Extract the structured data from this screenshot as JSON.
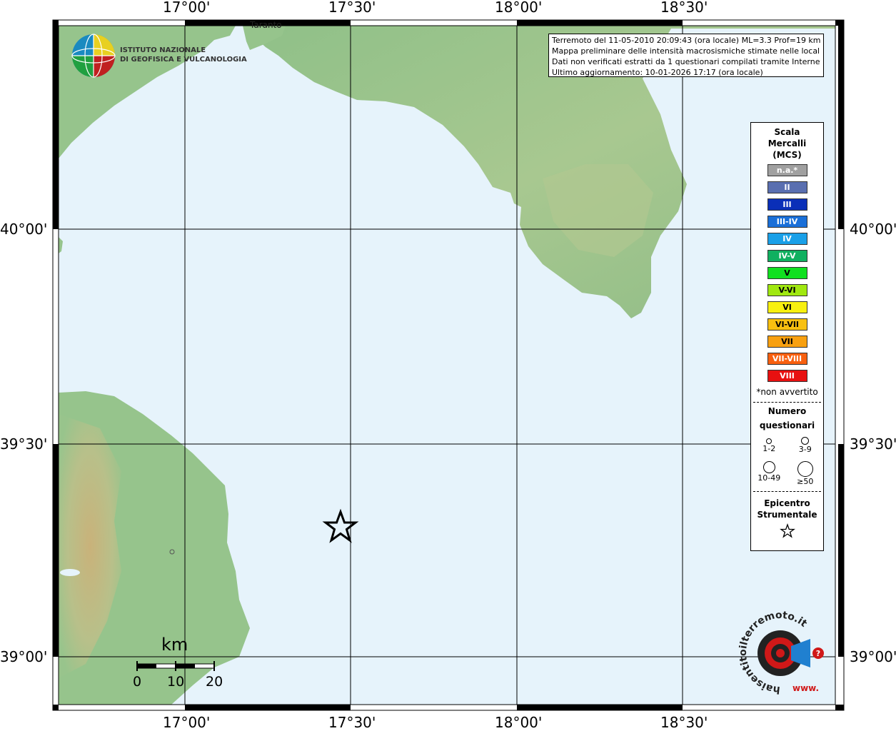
{
  "info": {
    "line1": "Terremoto del 11-05-2010 20:09:43 (ora locale) ML=3.3 Prof=19 km",
    "line2": "Mappa preliminare delle intensità macrosismiche stimate nelle località",
    "line3": "Dati non verificati estratti da 1 questionari compilati tramite Internet.",
    "line4": "Ultimo aggiornamento: 10-01-2026 17:17 (ora locale)"
  },
  "axes": {
    "top": [
      "17°00'",
      "17°30'",
      "18°00'",
      "18°30'"
    ],
    "bottom": [
      "17°00'",
      "17°30'",
      "18°00'",
      "18°30'"
    ],
    "left": [
      "40°00'",
      "39°30'",
      "39°00'"
    ],
    "right": [
      "40°00'",
      "39°30'",
      "39°00'"
    ]
  },
  "institute": {
    "line1": "ISTITUTO NAZIONALE",
    "line2": "DI GEOFISICA E VULCANOLOGIA"
  },
  "place": {
    "taranto": "Taranto"
  },
  "legend": {
    "title": [
      "Scala",
      "Mercalli",
      "(MCS)"
    ],
    "scale": [
      {
        "label": "n.a.*",
        "color": "#a0a0a0"
      },
      {
        "label": "II",
        "color": "#5a6fb0"
      },
      {
        "label": "III",
        "color": "#0a2fb8"
      },
      {
        "label": "III-IV",
        "color": "#1a6fd8"
      },
      {
        "label": "IV",
        "color": "#1aa0e8"
      },
      {
        "label": "IV-V",
        "color": "#10b060"
      },
      {
        "label": "V",
        "color": "#10e020"
      },
      {
        "label": "V-VI",
        "color": "#a0e810"
      },
      {
        "label": "VI",
        "color": "#f8f010"
      },
      {
        "label": "VI-VII",
        "color": "#f8c010"
      },
      {
        "label": "VII",
        "color": "#f8a010"
      },
      {
        "label": "VII-VIII",
        "color": "#f86010"
      },
      {
        "label": "VIII",
        "color": "#e81010"
      }
    ],
    "na_note": "*non avvertito",
    "questionnaire_title": [
      "Numero",
      "questionari"
    ],
    "questionnaire_sizes": [
      "1-2",
      "3-9",
      "10-49",
      "≥50"
    ],
    "epicenter_title": [
      "Epicentro",
      "Strumentale"
    ]
  },
  "scalebar": {
    "unit": "km",
    "ticks": [
      "0",
      "10",
      "20"
    ]
  },
  "haisentito": {
    "text": "haisentitoilterremoto.it",
    "www": "www."
  },
  "colors": {
    "sea": "#e6f3fb",
    "land": "#98c48c",
    "highland": "#c7b17a",
    "frame": "#000000"
  }
}
